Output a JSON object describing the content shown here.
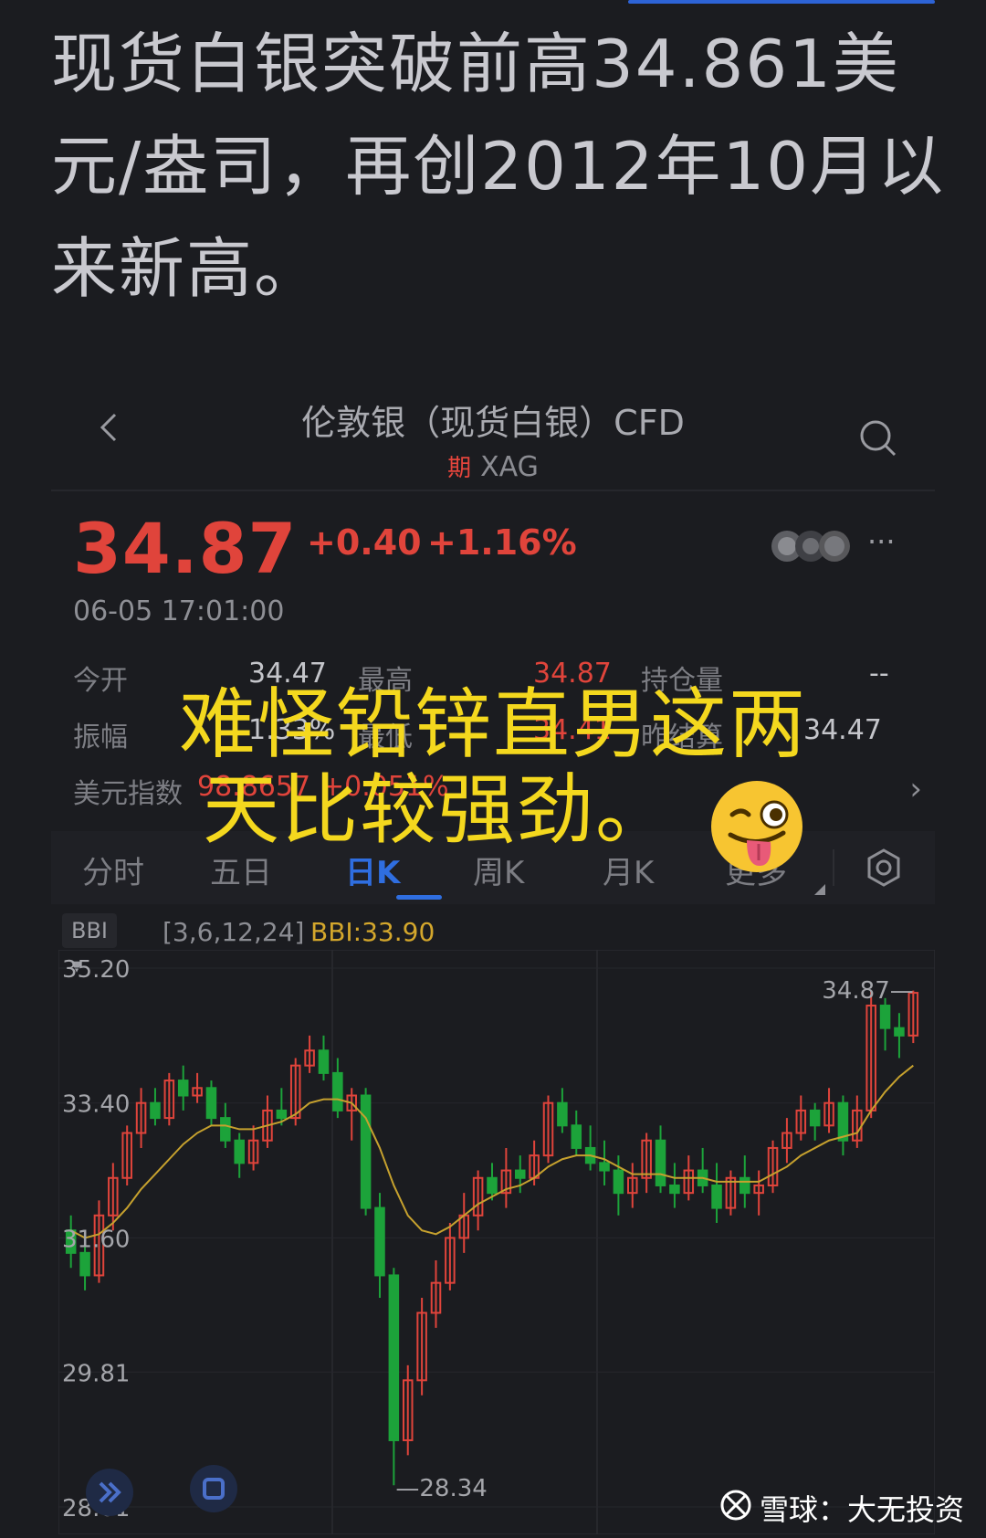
{
  "headline": "现货白银突破前高34.861美元/盎司，再创2012年10月以来新高。",
  "header": {
    "title": "伦敦银（现货白银）CFD",
    "tag": "期",
    "symbol": "XAG",
    "back_icon": "chevron-left-icon",
    "search_icon": "search-icon"
  },
  "quote": {
    "price": "34.87",
    "change": "+0.40",
    "change_pct": "+1.16%",
    "time": "06-05 17:01:00",
    "more": "···"
  },
  "stats": [
    {
      "label": "今开",
      "value": "34.47",
      "label2": "最高",
      "value2": "34.87",
      "label3": "持仓量",
      "value3": "--"
    },
    {
      "label": "振幅",
      "value": "1.33%",
      "label2": "最低",
      "value2": "34.41",
      "label3": "昨结算",
      "value3": "34.47"
    },
    {
      "label": "美元指数",
      "value": "98.8657",
      "label2": "",
      "value2": "+0.051%",
      "label3": "",
      "value3": ""
    }
  ],
  "tabs": [
    "分时",
    "五日",
    "日K",
    "周K",
    "月K",
    "更多"
  ],
  "active_tab": "日K",
  "indicator": {
    "name": "BBI",
    "params": "[3,6,12,24]",
    "value": "BBI:33.90"
  },
  "chart_data": {
    "type": "candlestick",
    "y_ticks": [
      "35.20",
      "33.40",
      "31.60",
      "29.81",
      "28.01"
    ],
    "ylim": [
      28.01,
      35.2
    ],
    "high_label": "34.87",
    "low_label": "28.34",
    "candles": [
      [
        31.7,
        31.9,
        31.2,
        31.4
      ],
      [
        31.4,
        31.5,
        30.9,
        31.1
      ],
      [
        31.1,
        32.1,
        31.0,
        31.9
      ],
      [
        31.9,
        32.6,
        31.7,
        32.4
      ],
      [
        32.4,
        33.1,
        32.3,
        33.0
      ],
      [
        33.0,
        33.6,
        32.8,
        33.4
      ],
      [
        33.4,
        33.6,
        33.1,
        33.2
      ],
      [
        33.2,
        33.8,
        33.1,
        33.7
      ],
      [
        33.7,
        33.9,
        33.3,
        33.5
      ],
      [
        33.5,
        33.8,
        33.4,
        33.6
      ],
      [
        33.6,
        33.7,
        33.1,
        33.2
      ],
      [
        33.2,
        33.4,
        32.8,
        32.9
      ],
      [
        32.9,
        33.0,
        32.4,
        32.6
      ],
      [
        32.6,
        33.1,
        32.5,
        32.9
      ],
      [
        32.9,
        33.5,
        32.8,
        33.3
      ],
      [
        33.3,
        33.6,
        33.1,
        33.2
      ],
      [
        33.2,
        34.0,
        33.1,
        33.9
      ],
      [
        33.9,
        34.3,
        33.8,
        34.1
      ],
      [
        34.1,
        34.3,
        33.7,
        33.8
      ],
      [
        33.8,
        34.0,
        33.2,
        33.3
      ],
      [
        33.3,
        33.6,
        32.9,
        33.5
      ],
      [
        33.5,
        33.6,
        31.9,
        32.0
      ],
      [
        32.0,
        32.2,
        30.8,
        31.1
      ],
      [
        31.1,
        31.2,
        28.3,
        28.9
      ],
      [
        28.9,
        29.9,
        28.7,
        29.7
      ],
      [
        29.7,
        30.8,
        29.5,
        30.6
      ],
      [
        30.6,
        31.3,
        30.4,
        31.0
      ],
      [
        31.0,
        31.8,
        30.9,
        31.6
      ],
      [
        31.6,
        32.2,
        31.4,
        31.9
      ],
      [
        31.9,
        32.5,
        31.7,
        32.4
      ],
      [
        32.4,
        32.6,
        32.1,
        32.2
      ],
      [
        32.2,
        32.8,
        32.0,
        32.5
      ],
      [
        32.5,
        32.7,
        32.2,
        32.4
      ],
      [
        32.4,
        32.9,
        32.3,
        32.7
      ],
      [
        32.7,
        33.5,
        32.6,
        33.4
      ],
      [
        33.4,
        33.6,
        33.0,
        33.1
      ],
      [
        33.1,
        33.3,
        32.7,
        32.8
      ],
      [
        32.8,
        33.1,
        32.5,
        32.6
      ],
      [
        32.6,
        32.9,
        32.3,
        32.5
      ],
      [
        32.5,
        32.7,
        31.9,
        32.2
      ],
      [
        32.2,
        32.6,
        32.0,
        32.4
      ],
      [
        32.4,
        33.0,
        32.2,
        32.9
      ],
      [
        32.9,
        33.1,
        32.2,
        32.3
      ],
      [
        32.3,
        32.6,
        32.0,
        32.2
      ],
      [
        32.2,
        32.7,
        32.1,
        32.5
      ],
      [
        32.5,
        32.8,
        32.2,
        32.3
      ],
      [
        32.3,
        32.6,
        31.8,
        32.0
      ],
      [
        32.0,
        32.5,
        31.9,
        32.4
      ],
      [
        32.4,
        32.7,
        32.0,
        32.2
      ],
      [
        32.2,
        32.5,
        31.9,
        32.3
      ],
      [
        32.3,
        32.9,
        32.2,
        32.8
      ],
      [
        32.8,
        33.2,
        32.6,
        33.0
      ],
      [
        33.0,
        33.5,
        32.9,
        33.3
      ],
      [
        33.3,
        33.4,
        32.9,
        33.1
      ],
      [
        33.1,
        33.6,
        33.0,
        33.4
      ],
      [
        33.4,
        33.5,
        32.7,
        32.9
      ],
      [
        32.9,
        33.5,
        32.8,
        33.3
      ],
      [
        33.3,
        34.9,
        33.2,
        34.7
      ],
      [
        34.7,
        34.8,
        34.1,
        34.4
      ],
      [
        34.4,
        34.6,
        34.0,
        34.3
      ],
      [
        34.3,
        34.9,
        34.2,
        34.87
      ]
    ],
    "bbi": [
      31.7,
      31.6,
      31.65,
      31.8,
      32.0,
      32.25,
      32.45,
      32.65,
      32.85,
      33.0,
      33.1,
      33.1,
      33.05,
      33.05,
      33.1,
      33.15,
      33.25,
      33.4,
      33.45,
      33.45,
      33.4,
      33.2,
      32.8,
      32.3,
      31.9,
      31.7,
      31.65,
      31.75,
      31.9,
      32.05,
      32.15,
      32.25,
      32.3,
      32.4,
      32.55,
      32.65,
      32.7,
      32.7,
      32.65,
      32.55,
      32.45,
      32.45,
      32.45,
      32.4,
      32.4,
      32.4,
      32.35,
      32.35,
      32.35,
      32.35,
      32.45,
      32.55,
      32.7,
      32.8,
      32.9,
      32.95,
      33.0,
      33.3,
      33.55,
      33.75,
      33.9
    ]
  },
  "caption": [
    "难怪铅锌直男这两",
    "天比较强劲。"
  ],
  "emoji": "winking-face-with-tongue-icon",
  "watermark": "雪球：大无投资",
  "colors": {
    "up": "#e0443b",
    "down": "#1ca33a",
    "bbi": "#c6a12e",
    "accent": "#2f6ee0",
    "caption": "#f4d81e"
  }
}
